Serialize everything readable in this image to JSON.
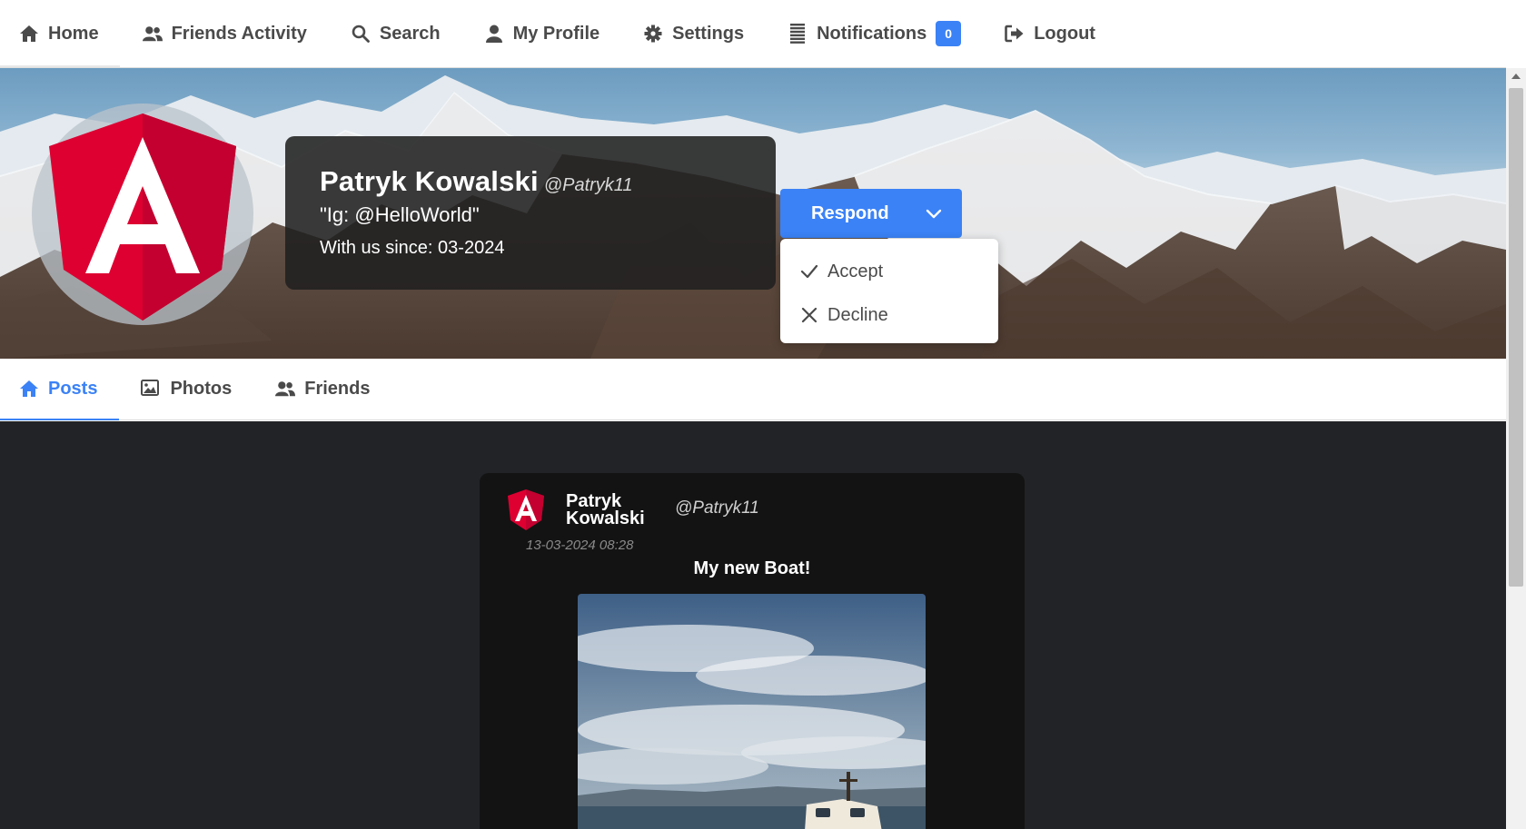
{
  "nav": {
    "items": [
      {
        "label": "Home",
        "icon": "home-icon"
      },
      {
        "label": "Friends Activity",
        "icon": "users-icon"
      },
      {
        "label": "Search",
        "icon": "search-icon"
      },
      {
        "label": "My Profile",
        "icon": "user-icon"
      },
      {
        "label": "Settings",
        "icon": "gear-icon"
      },
      {
        "label": "Notifications",
        "icon": "list-icon"
      },
      {
        "label": "Logout",
        "icon": "logout-icon"
      }
    ],
    "notifications_count": "0"
  },
  "profile": {
    "name": "Patryk Kowalski",
    "handle": "@Patryk11",
    "bio": "\"Ig: @HelloWorld\"",
    "since": "With us since: 03-2024"
  },
  "respond": {
    "label": "Respond",
    "options": [
      {
        "label": "Accept",
        "icon": "check-icon"
      },
      {
        "label": "Decline",
        "icon": "x-icon"
      }
    ]
  },
  "tabs": [
    {
      "label": "Posts",
      "icon": "home-icon",
      "active": true
    },
    {
      "label": "Photos",
      "icon": "image-icon",
      "active": false
    },
    {
      "label": "Friends",
      "icon": "users-icon",
      "active": false
    }
  ],
  "post": {
    "author_first": "Patryk",
    "author_last": "Kowalski",
    "handle": "@Patryk11",
    "date": "13-03-2024 08:28",
    "title": "My new Boat!"
  },
  "colors": {
    "accent": "#3b82f6",
    "brand_red": "#dd0031",
    "content_bg": "#222326"
  }
}
